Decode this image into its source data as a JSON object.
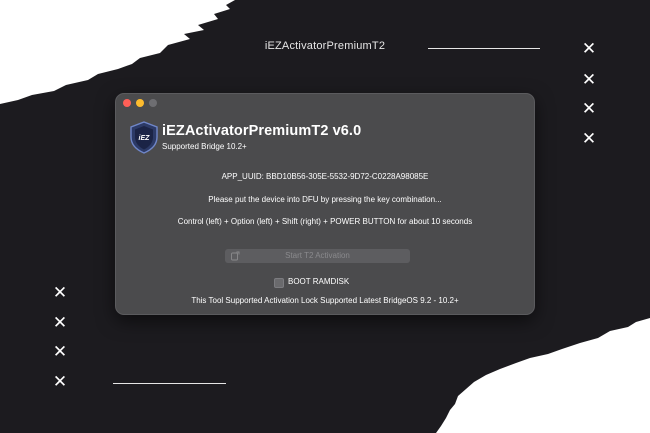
{
  "banner": {
    "title": "iEZActivatorPremiumT2"
  },
  "window": {
    "app_title": "iEZActivatorPremiumT2 v6.0",
    "app_subtitle": "Supported Bridge 10.2+",
    "logo_text": "iEZ",
    "uuid_line": "APP_UUID: BBD10B56-305E-5532-9D72-C0228A98085E",
    "instruction_line": "Please put the device into DFU by pressing the key combination...",
    "keys_line": "Control (left) + Option (left) + Shift (right) + POWER BUTTON for about 10 seconds",
    "start_button_label": "Start T2 Activation",
    "checkbox_label": "BOOT RAMDISK",
    "checkbox_checked": false,
    "footer_line": "This Tool Supported Activation Lock Supported Latest BridgeOS 9.2 - 10.2+"
  },
  "decor": {
    "x_glyph": "✕"
  },
  "colors": {
    "page_background": "#1c1b1f",
    "torn_paper": "#ffffff",
    "window_background": "#4b4b4d",
    "button_background": "#5d5d60",
    "traffic_close": "#ff5f57",
    "traffic_minimize": "#febc2e",
    "traffic_zoom_inactive": "#6e6e72"
  }
}
